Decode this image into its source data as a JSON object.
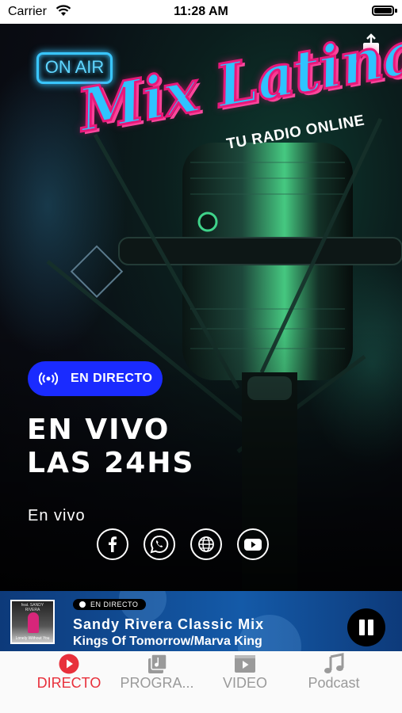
{
  "status_bar": {
    "carrier": "Carrier",
    "time": "11:28 AM"
  },
  "logo": {
    "badge": "ON AIR",
    "name": "Mix Latina",
    "tagline": "TU RADIO ONLINE"
  },
  "hero": {
    "live_pill": "EN DIRECTO",
    "headline_line1": "EN VIVO",
    "headline_line2": "LAS 24HS",
    "subtitle": "En vivo"
  },
  "socials": [
    {
      "icon": "facebook-icon"
    },
    {
      "icon": "whatsapp-icon"
    },
    {
      "icon": "globe-icon"
    },
    {
      "icon": "youtube-icon"
    }
  ],
  "player": {
    "live_label": "EN DIRECTO",
    "title": "Sandy Rivera Classic Mix",
    "artist": "Kings Of Tomorrow/Marva King",
    "cover_caption_top": "feat. SANDY RIVERA",
    "cover_caption_bottom": "Lonely Without You"
  },
  "tabs": [
    {
      "label": "DIRECTO",
      "icon": "play-circle-icon",
      "active": true
    },
    {
      "label": "PROGRA...",
      "icon": "music-library-icon",
      "active": false
    },
    {
      "label": "VIDEO",
      "icon": "video-icon",
      "active": false
    },
    {
      "label": "Podcast",
      "icon": "music-note-icon",
      "active": false
    }
  ],
  "colors": {
    "accent": "#e8303b",
    "live_pill": "#1a2bff",
    "player_bg": "#145aa8",
    "logo_blue": "#2fc3ff",
    "logo_pink": "#e8187a"
  }
}
